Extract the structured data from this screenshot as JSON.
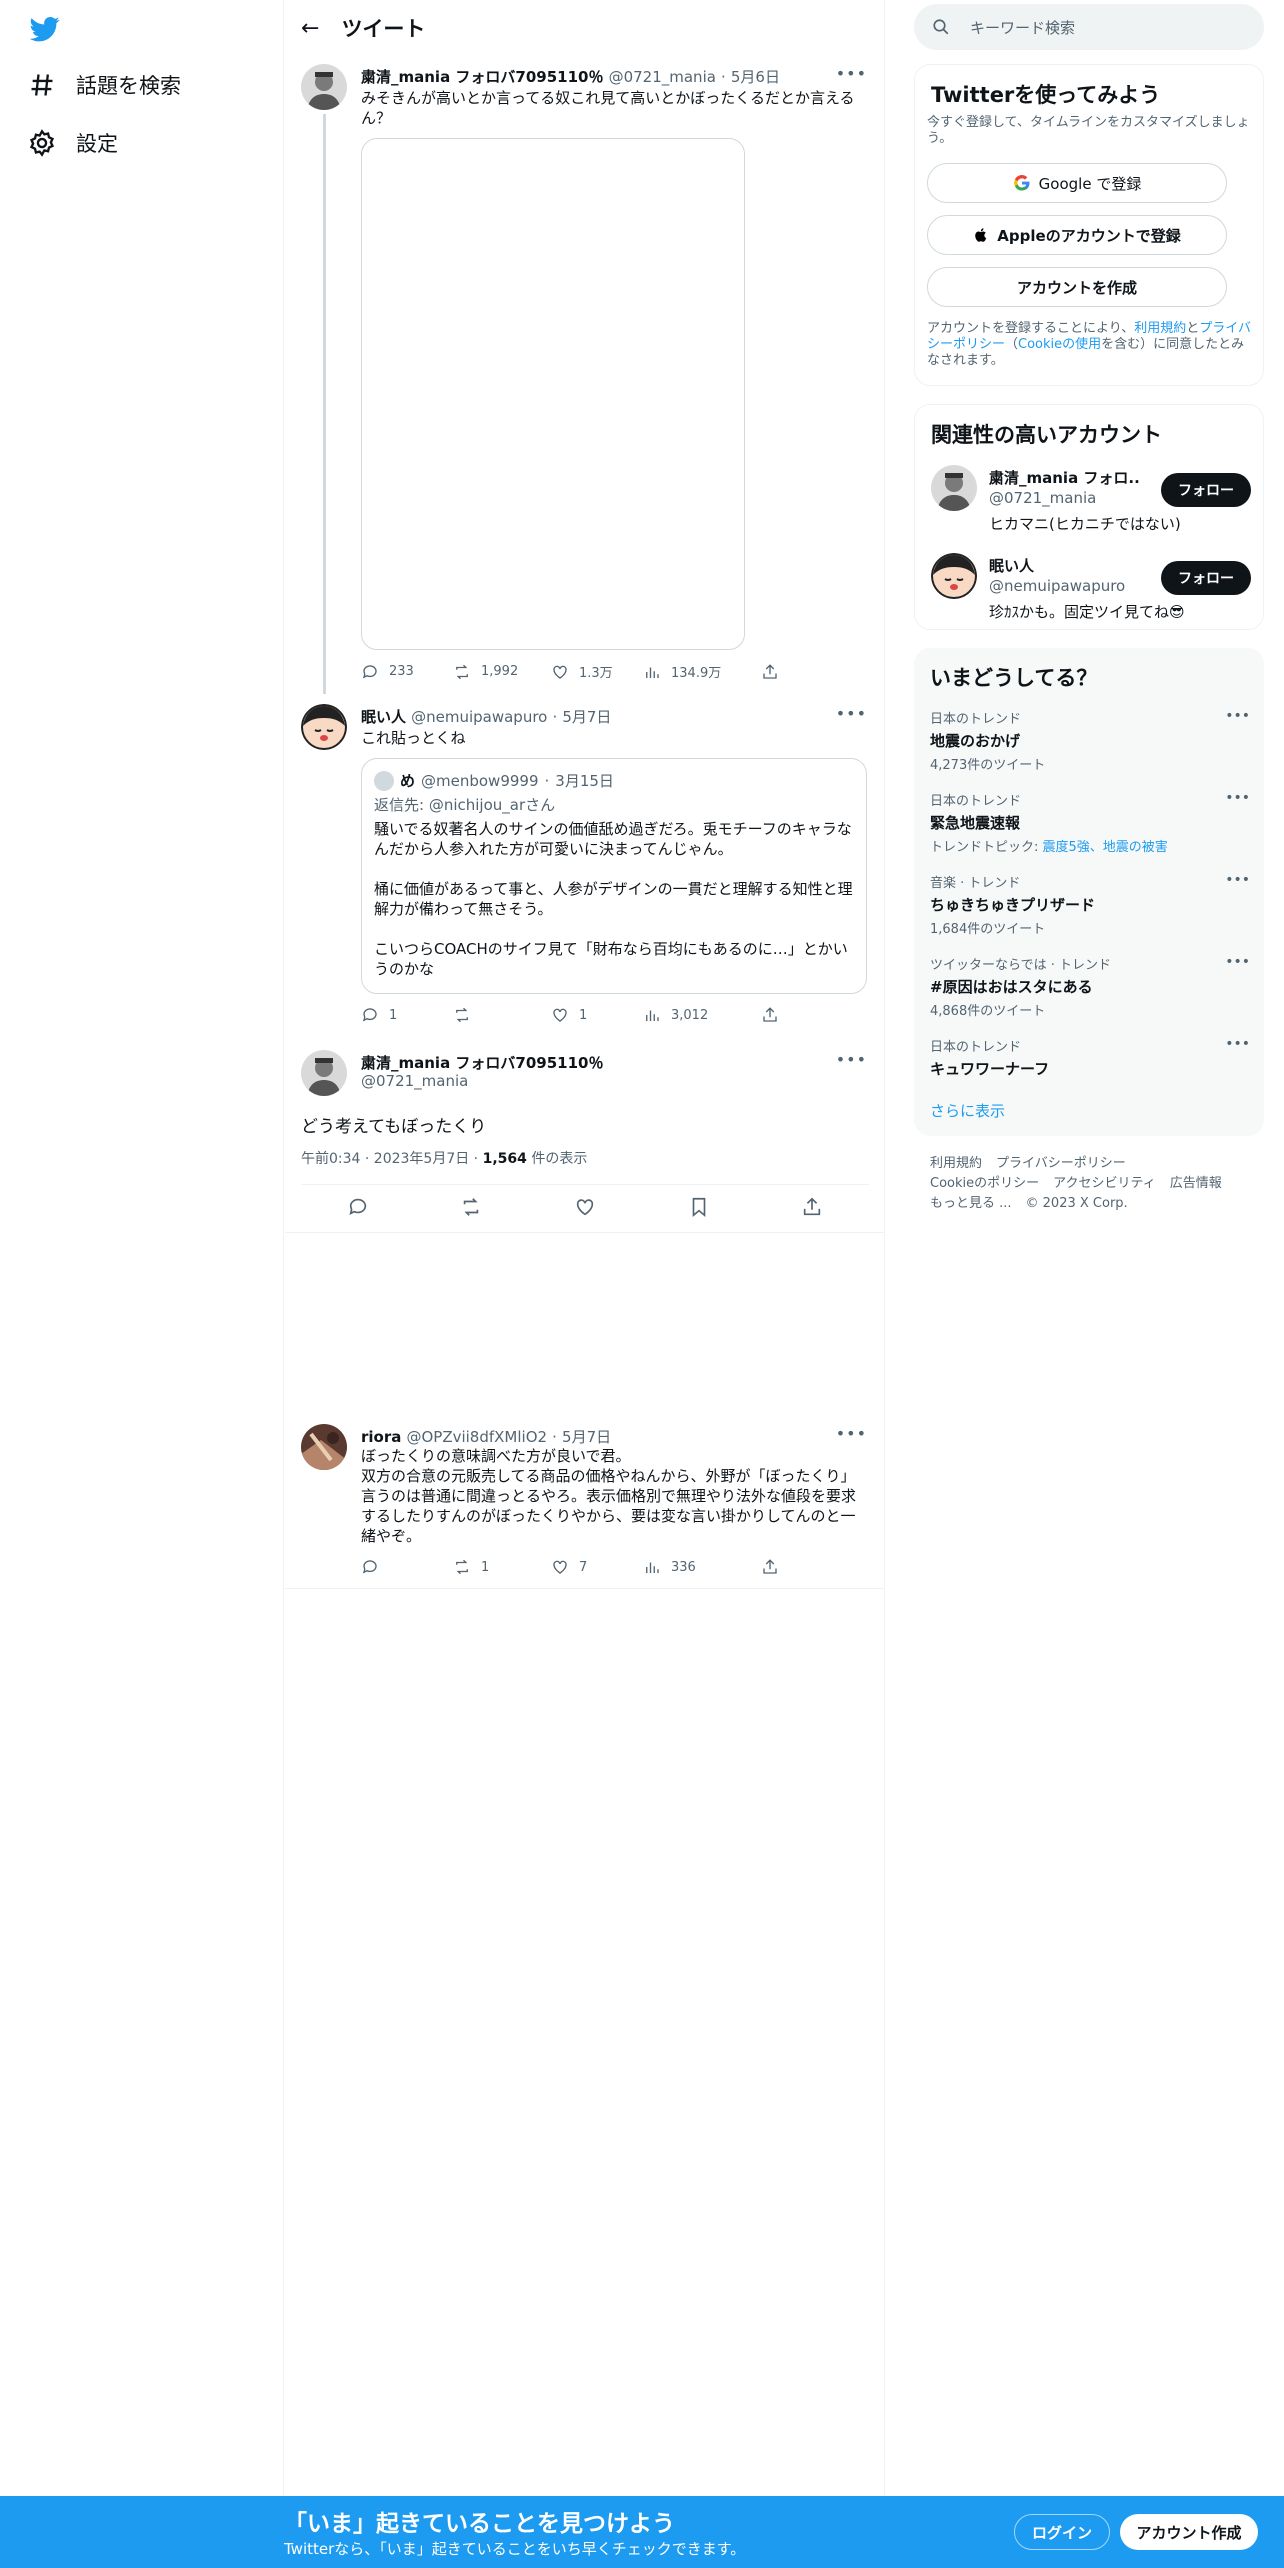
{
  "nav": {
    "items": [
      {
        "label": "話題を検索"
      },
      {
        "label": "設定"
      }
    ]
  },
  "header": {
    "title": "ツイート"
  },
  "tweets": [
    {
      "name": "粛清_mania フォロバ7095110％",
      "handle": "@0721_mania",
      "time": "5月6日",
      "text": "みそきんが高いとか言ってる奴これ見て高いとかぼったくるだとか言えるん？",
      "replies": "233",
      "retweets": "1,992",
      "likes": "1.3万",
      "views": "134.9万"
    },
    {
      "name": "眠い人",
      "handle": "@nemuipawapuro",
      "time": "5月7日",
      "text": "これ貼っとくね",
      "quote": {
        "name": "め",
        "handle": "@menbow9999",
        "time": "3月15日",
        "reply_to": "返信先: @nichijou_arさん",
        "p1": "騒いでる奴著名人のサインの価値舐め過ぎだろ。兎モチーフのキャラなんだから人参入れた方が可愛いに決まってんじゃん。",
        "p2": "桶に価値があるって事と、人参がデザインの一貫だと理解する知性と理解力が備わって無さそう。",
        "p3": "こいつらCOACHのサイフ見て「財布なら百均にもあるのに…」とかいうのかな"
      },
      "replies": "1",
      "retweets": "",
      "likes": "1",
      "views": "3,012"
    },
    {
      "name": "粛清_mania フォロバ7095110％",
      "handle": "@0721_mania",
      "text": "どう考えてもぼったくり",
      "time_full": "午前0:34 · 2023年5月7日 · ",
      "views_count": "1,564",
      "views_label": " 件の表示"
    },
    {
      "name": "riora",
      "handle": "@OPZvii8dfXMliO2",
      "time": "5月7日",
      "text1": "ぼったくりの意味調べた方が良いで君。",
      "text2": "双方の合意の元販売してる商品の価格やねんから、外野が「ぼったくり」言うのは普通に間違っとるやろ。表示価格別で無理やり法外な値段を要求するしたりすんのがぼったくりやから、要は変な言い掛かりしてんのと一緒やぞ。",
      "replies": "",
      "retweets": "1",
      "likes": "7",
      "views": "336"
    }
  ],
  "search": {
    "placeholder": "キーワード検索"
  },
  "signup": {
    "title": "Twitterを使ってみよう",
    "subtitle": "今すぐ登録して、タイムラインをカスタマイズしましょう。",
    "google": "Google で登録",
    "apple": "Appleのアカウントで登録",
    "create": "アカウントを作成",
    "legal1": "アカウントを登録することにより、",
    "terms": "利用規約",
    "and": "と",
    "privacy": "プライバシーポリシー",
    "cookie_open": "（",
    "cookie": "Cookieの使用",
    "legal2": "を含む）に同意したとみなされます。"
  },
  "related": {
    "title": "関連性の高いアカウント",
    "accounts": [
      {
        "name": "粛清_mania フォロ...",
        "handle": "@0721_mania",
        "bio": "ヒカマニ(ヒカニチではない)",
        "follow": "フォロー"
      },
      {
        "name": "眠い人",
        "handle": "@nemuipawapuro",
        "bio": "珍ｶｽかも。固定ツイ見てね😎",
        "follow": "フォロー"
      }
    ]
  },
  "trends": {
    "title": "いまどうしてる？",
    "items": [
      {
        "cat": "日本のトレンド",
        "name": "地震のおかげ",
        "cnt": "4,273件のツイート"
      },
      {
        "cat": "日本のトレンド",
        "name": "緊急地震速報",
        "topic_prefix": "トレンドトピック: ",
        "topic": "震度5強、地震の被害"
      },
      {
        "cat": "音楽 · トレンド",
        "name": "ちゅきちゅきプリザード",
        "cnt": "1,684件のツイート"
      },
      {
        "cat": "ツイッターならでは · トレンド",
        "name": "#原因はおはスタにある",
        "cnt": "4,868件のツイート"
      },
      {
        "cat": "日本のトレンド",
        "name": "キュワワーナーフ"
      }
    ],
    "more": "さらに表示"
  },
  "footer": {
    "terms": "利用規約",
    "privacy": "プライバシーポリシー",
    "cookie": "Cookieのポリシー",
    "access": "アクセシビリティ",
    "ads": "広告情報",
    "more": "もっと見る ...",
    "copy": "© 2023 X Corp."
  },
  "banner": {
    "title": "「いま」起きていることを見つけよう",
    "subtitle": "Twitterなら、「いま」起きていることをいち早くチェックできます。",
    "login": "ログイン",
    "signup": "アカウント作成"
  },
  "colors": {
    "accent": "#1d9bf0",
    "text": "#0f1419",
    "muted": "#536471"
  }
}
